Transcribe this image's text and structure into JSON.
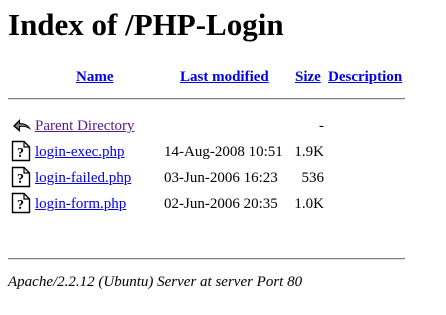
{
  "page": {
    "title": "Index of /PHP-Login"
  },
  "table": {
    "headers": {
      "name": "Name",
      "last_modified": "Last modified",
      "size": "Size",
      "description": "Description"
    },
    "parent": {
      "icon": "back-arrow-icon",
      "label": "Parent Directory",
      "size": "-"
    },
    "rows": [
      {
        "icon": "unknown-file-icon",
        "name": "login-exec.php",
        "modified": "14-Aug-2008 10:51",
        "size": "1.9K"
      },
      {
        "icon": "unknown-file-icon",
        "name": "login-failed.php",
        "modified": "03-Jun-2006 16:23",
        "size": "536"
      },
      {
        "icon": "unknown-file-icon",
        "name": "login-form.php",
        "modified": "02-Jun-2006 20:35",
        "size": "1.0K"
      }
    ]
  },
  "footer": {
    "address": "Apache/2.2.12 (Ubuntu) Server at server Port 80"
  },
  "colors": {
    "link": "#0000ee",
    "visited_link": "#551a8b",
    "text": "#000000",
    "background": "#ffffff"
  }
}
